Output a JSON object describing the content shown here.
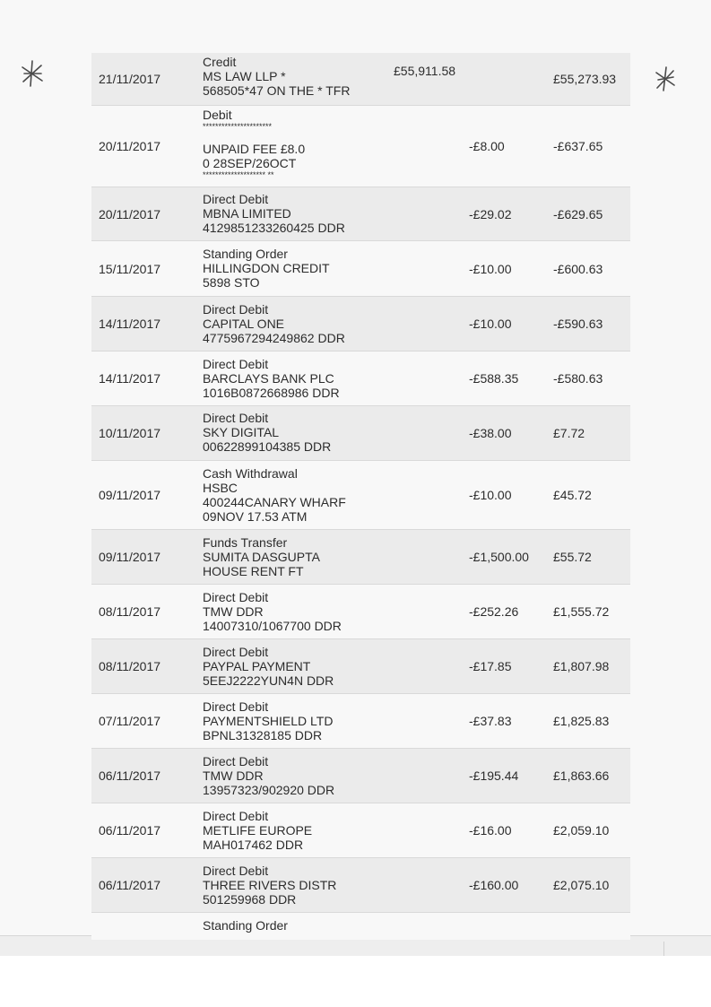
{
  "transactions": [
    {
      "date": "21/11/2017",
      "lines": [
        "Credit",
        "MS LAW LLP *",
        "568505*47 ON THE * TFR"
      ],
      "credit": "£55,911.58",
      "debit": "",
      "balance": "£55,273.93"
    },
    {
      "date": "20/11/2017",
      "lines": [
        "Debit",
        "**********************",
        "UNPAID FEE £8.0",
        "0 28SEP/26OCT",
        "******************** **"
      ],
      "credit": "",
      "debit": "-£8.00",
      "balance": "-£637.65"
    },
    {
      "date": "20/11/2017",
      "lines": [
        "Direct Debit",
        "MBNA LIMITED",
        "4129851233260425 DDR"
      ],
      "credit": "",
      "debit": "-£29.02",
      "balance": "-£629.65"
    },
    {
      "date": "15/11/2017",
      "lines": [
        "Standing Order",
        "HILLINGDON CREDIT",
        "5898 STO"
      ],
      "credit": "",
      "debit": "-£10.00",
      "balance": "-£600.63"
    },
    {
      "date": "14/11/2017",
      "lines": [
        "Direct Debit",
        "CAPITAL ONE",
        "4775967294249862 DDR"
      ],
      "credit": "",
      "debit": "-£10.00",
      "balance": "-£590.63"
    },
    {
      "date": "14/11/2017",
      "lines": [
        "Direct Debit",
        "BARCLAYS BANK PLC",
        "1016B0872668986 DDR"
      ],
      "credit": "",
      "debit": "-£588.35",
      "balance": "-£580.63"
    },
    {
      "date": "10/11/2017",
      "lines": [
        "Direct Debit",
        "SKY DIGITAL",
        "00622899104385 DDR"
      ],
      "credit": "",
      "debit": "-£38.00",
      "balance": "£7.72"
    },
    {
      "date": "09/11/2017",
      "lines": [
        "Cash Withdrawal",
        "HSBC",
        "400244CANARY WHARF",
        "09NOV 17.53 ATM"
      ],
      "credit": "",
      "debit": "-£10.00",
      "balance": "£45.72"
    },
    {
      "date": "09/11/2017",
      "lines": [
        "Funds Transfer",
        "SUMITA DASGUPTA",
        "HOUSE RENT FT"
      ],
      "credit": "",
      "debit": "-£1,500.00",
      "balance": "£55.72"
    },
    {
      "date": "08/11/2017",
      "lines": [
        "Direct Debit",
        "TMW DDR",
        "14007310/1067700 DDR"
      ],
      "credit": "",
      "debit": "-£252.26",
      "balance": "£1,555.72"
    },
    {
      "date": "08/11/2017",
      "lines": [
        "Direct Debit",
        "PAYPAL PAYMENT",
        "5EEJ2222YUN4N DDR"
      ],
      "credit": "",
      "debit": "-£17.85",
      "balance": "£1,807.98"
    },
    {
      "date": "07/11/2017",
      "lines": [
        "Direct Debit",
        "PAYMENTSHIELD LTD",
        "BPNL31328185 DDR"
      ],
      "credit": "",
      "debit": "-£37.83",
      "balance": "£1,825.83"
    },
    {
      "date": "06/11/2017",
      "lines": [
        "Direct Debit",
        "TMW DDR",
        "13957323/902920 DDR"
      ],
      "credit": "",
      "debit": "-£195.44",
      "balance": "£1,863.66"
    },
    {
      "date": "06/11/2017",
      "lines": [
        "Direct Debit",
        "METLIFE EUROPE",
        "MAH017462 DDR"
      ],
      "credit": "",
      "debit": "-£16.00",
      "balance": "£2,059.10"
    },
    {
      "date": "06/11/2017",
      "lines": [
        "Direct Debit",
        "THREE RIVERS DISTR",
        "501259968 DDR"
      ],
      "credit": "",
      "debit": "-£160.00",
      "balance": "£2,075.10"
    },
    {
      "date": "",
      "lines": [
        "Standing Order"
      ],
      "credit": "",
      "debit": "",
      "balance": ""
    }
  ],
  "marks": {
    "color": "#4a4a4a"
  }
}
